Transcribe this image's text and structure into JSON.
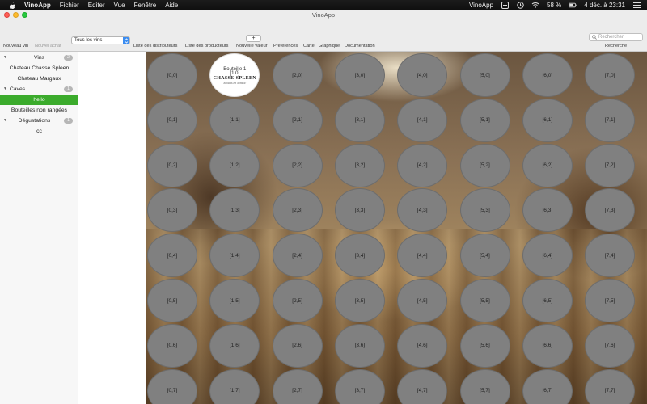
{
  "menubar": {
    "app": "VinoApp",
    "menus": [
      "Fichier",
      "Editer",
      "Vue",
      "Fenêtre",
      "Aide"
    ],
    "status_app": "VinoApp",
    "battery": "58 %",
    "clock": "4 déc. à 23:31"
  },
  "window": {
    "title": "VinoApp"
  },
  "toolbar": {
    "new_wine": "Nouveau vin",
    "new_purchase": "Nouvel achat",
    "wine_filter": "Tous les vins",
    "plus": "+",
    "distributors": "Liste des distributeurs",
    "producers": "Liste des producteurs",
    "new_value": "Nouvelle valeur",
    "preferences": "Préférences",
    "map": "Carte",
    "chart": "Graphique",
    "docs": "Documentation",
    "search_placeholder": "Rechercher",
    "search_label": "Recherche"
  },
  "sidebar": {
    "wines_header": "Vins",
    "wines_count": "2",
    "wines": [
      "Chateau Chasse Spleen",
      "Chateau Margaux"
    ],
    "cellars_header": "Caves",
    "cellars_count": "1",
    "cellars": [
      "hello"
    ],
    "unsorted": "Bouteilles non rangées",
    "tastings_header": "Dégustations",
    "tastings_count": "1",
    "tastings": [
      "cc"
    ]
  },
  "cellar": {
    "columns": 8,
    "rows": 8,
    "occupied": {
      "col": 1,
      "row": 0,
      "bottle_label": "Bouteille 1",
      "coord": "[1,0]",
      "brand": "CHASSE-SPLEEN",
      "subtitle": "Moulis en Médoc"
    }
  }
}
